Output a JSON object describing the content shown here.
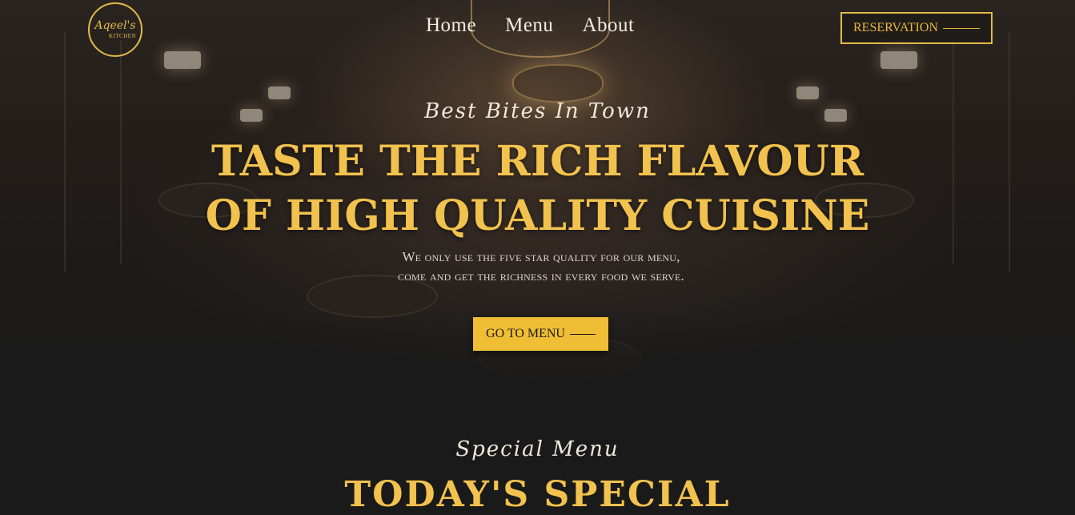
{
  "brand": {
    "logo_line1": "Aqeel's",
    "logo_line2": "KITCHEN"
  },
  "nav": {
    "items": [
      "Home",
      "Menu",
      "About"
    ]
  },
  "header": {
    "reservation_label": "RESERVATION"
  },
  "hero": {
    "kicker": "Best Bites In Town",
    "headline_line1": "TASTE THE RICH FLAVOUR",
    "headline_line2": "OF HIGH QUALITY CUISINE",
    "description": "We only use the five star quality for our menu, come and get the richness in every food we serve.",
    "cta_label": "GO TO MENU"
  },
  "special_section": {
    "kicker": "Special Menu",
    "title": "TODAY'S SPECIAL"
  },
  "colors": {
    "accent": "#f0be35",
    "background": "#1a1a1a",
    "text": "#efe8dc"
  }
}
